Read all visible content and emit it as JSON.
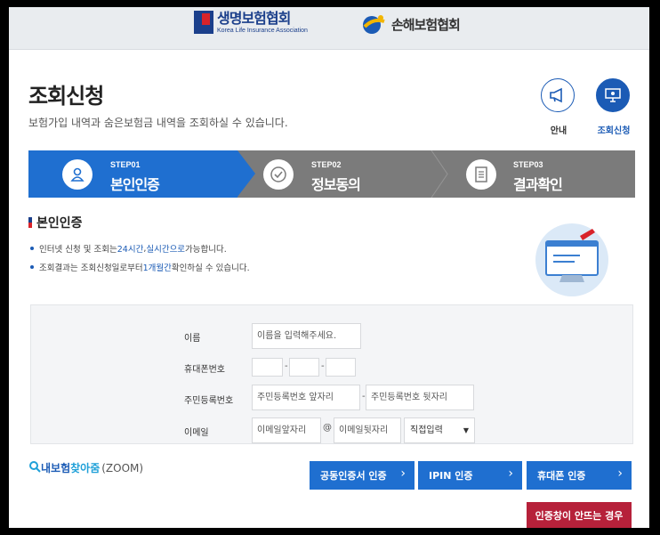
{
  "header": {
    "logo1_name": "생명보험협회",
    "logo1_sub": "Korea Life Insurance Association",
    "logo2_name": "손해보험협회"
  },
  "page": {
    "title": "조회신청",
    "description": "보험가입 내역과 숨은보험금 내역을 조회하실 수 있습니다."
  },
  "top_buttons": {
    "guide_label": "안내",
    "inquiry_label": "조회신청"
  },
  "steps": [
    {
      "num": "STEP01",
      "name": "본인인증"
    },
    {
      "num": "STEP02",
      "name": "정보동의"
    },
    {
      "num": "STEP03",
      "name": "결과확인"
    }
  ],
  "section": {
    "title": "본인인증",
    "bullet1_pre": "인터넷 신청 및 조회는 ",
    "bullet1_hl1": "24시간",
    "bullet1_mid": ", ",
    "bullet1_hl2": "실시간으로",
    "bullet1_post": " 가능합니다.",
    "bullet2_pre": "조회결과는 조회신청일로부터 ",
    "bullet2_hl": "1개월간",
    "bullet2_post": " 확인하실 수 있습니다."
  },
  "form": {
    "name_label": "이름",
    "name_placeholder": "이름을 입력해주세요.",
    "phone_label": "휴대폰번호",
    "phone_sep": "-",
    "rrn_label": "주민등록번호",
    "rrn_front_placeholder": "주민등록번호 앞자리",
    "rrn_sep": "-",
    "rrn_back_placeholder": "주민등록번호 뒷자리",
    "email_label": "이메일",
    "email_front_placeholder": "이메일앞자리",
    "email_at": "@",
    "email_back_placeholder": "이메일뒷자리",
    "email_domain_selected": "직접입력"
  },
  "bottom": {
    "zoom_pre": "내보험",
    "zoom_em": "찾아줌",
    "zoom_tag": "(ZOOM)",
    "btn_cert": "공동인증서 인증",
    "btn_ipin": "IPIN 인증",
    "btn_phone": "휴대폰 인증",
    "btn_popup": "인증창이 안뜨는 경우"
  },
  "colors": {
    "accent": "#1f6fd0",
    "step_inactive": "#7b7b7b",
    "alert_button": "#b6213a"
  }
}
